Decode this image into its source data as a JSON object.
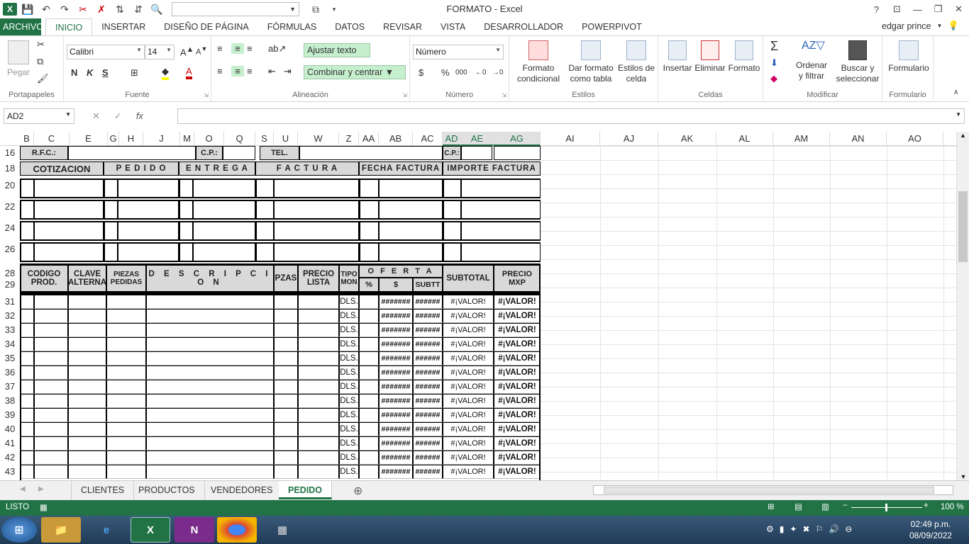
{
  "window": {
    "title": "FORMATO - Excel",
    "help": "?",
    "min": "—",
    "restore": "❐",
    "close": "✕"
  },
  "qat": {
    "combo_value": ""
  },
  "tabs": [
    "ARCHIVO",
    "INICIO",
    "INSERTAR",
    "DISEÑO DE PÁGINA",
    "FÓRMULAS",
    "DATOS",
    "REVISAR",
    "VISTA",
    "DESARROLLADOR",
    "POWERPIVOT"
  ],
  "user": "edgar prince",
  "ribbon": {
    "portapapeles": {
      "label": "Portapapeles",
      "paste": "Pegar"
    },
    "fuente": {
      "label": "Fuente",
      "font": "Calibri",
      "size": "14",
      "bold": "N",
      "italic": "K",
      "underline": "S"
    },
    "alineacion": {
      "label": "Alineación",
      "wrap": "Ajustar texto",
      "merge": "Combinar y centrar"
    },
    "numero": {
      "label": "Número",
      "format": "Número",
      "currency": "$",
      "percent": "%",
      "thousands": "000"
    },
    "estilos": {
      "label": "Estilos",
      "cond1": "Formato",
      "cond2": "condicional",
      "table1": "Dar formato",
      "table2": "como tabla",
      "cell1": "Estilos de",
      "cell2": "celda"
    },
    "celdas": {
      "label": "Celdas",
      "insert": "Insertar",
      "delete": "Eliminar",
      "format": "Formato"
    },
    "modificar": {
      "label": "Modificar",
      "sort1": "Ordenar",
      "sort2": "y filtrar",
      "find1": "Buscar y",
      "find2": "seleccionar"
    },
    "formulario": {
      "label": "Formulario",
      "btn": "Formulario"
    }
  },
  "formula": {
    "namebox": "AD2",
    "fx": "fx",
    "cancel": "✕",
    "enter": "✓",
    "content": ""
  },
  "columns": [
    "B",
    "C",
    "E",
    "G",
    "H",
    "J",
    "M",
    "O",
    "Q",
    "S",
    "U",
    "W",
    "Z",
    "AA",
    "AB",
    "AC",
    "AD",
    "AE",
    "AG",
    "AI",
    "AJ",
    "AK",
    "AL",
    "AM",
    "AN",
    "AO"
  ],
  "rows": [
    "16",
    "18",
    "20",
    "22",
    "24",
    "26",
    "28",
    "29",
    "31",
    "32",
    "33",
    "34",
    "35",
    "36",
    "37",
    "38",
    "39",
    "40",
    "41",
    "42",
    "43"
  ],
  "sheet": {
    "rfc": "R.F.C.:",
    "cp": "C.P.:",
    "tel": "TEL.",
    "cp2": "C.P.:",
    "headers1": [
      "COTIZACION",
      "P E D I D O",
      "E N T R E G A",
      "F A C T U R A",
      "FECHA FACTURA",
      "IMPORTE FACTURA"
    ],
    "h_codigo": "CODIGO PROD.",
    "h_clave": "CLAVE ALTERNA",
    "h_piezas": "PIEZAS PEDIDAS",
    "h_desc": "D E S C R I P C I O N",
    "h_pzas": "PZAS",
    "h_precio": "PRECIO LISTA",
    "h_tipo": "TIPO MON",
    "h_oferta": "O F E R T A",
    "h_pct": "%",
    "h_dollar": "$",
    "h_subtt": "SUBTT",
    "h_subtotal": "SUBTOTAL",
    "h_preciomxp": "PRECIO MXP",
    "item_tipo": "DLS.",
    "item_hash7": "#######",
    "item_hash6": "######",
    "item_valor": "#¡VALOR!"
  },
  "sheettabs": [
    "CLIENTES",
    "PRODUCTOS",
    "VENDEDORES",
    "PEDIDO"
  ],
  "status": {
    "ready": "LISTO",
    "zoom": "100 %"
  },
  "taskbar": {
    "time": "02:49 p.m.",
    "date": "08/09/2022"
  }
}
